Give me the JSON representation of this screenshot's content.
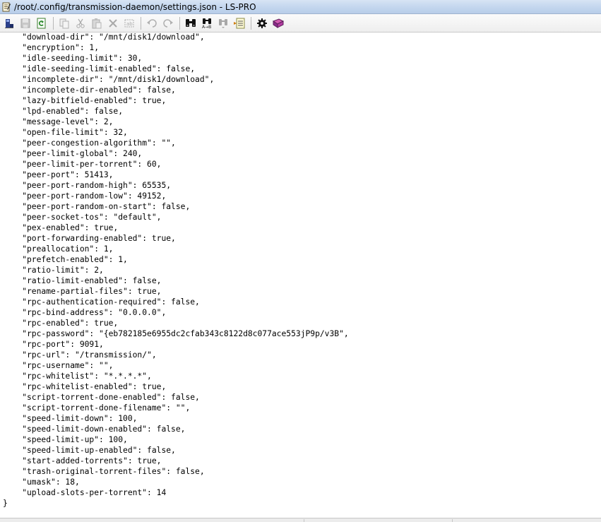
{
  "window": {
    "title": "/root/.config/transmission-daemon/settings.json - LS-PRO"
  },
  "toolbar": {
    "buttons": [
      {
        "name": "open-remote-icon",
        "enabled": true
      },
      {
        "name": "save-icon",
        "enabled": false
      },
      {
        "name": "reload-icon",
        "enabled": true
      },
      {
        "name": "copy-icon",
        "enabled": false
      },
      {
        "name": "cut-icon",
        "enabled": false
      },
      {
        "name": "paste-icon",
        "enabled": false
      },
      {
        "name": "delete-icon",
        "enabled": false
      },
      {
        "name": "select-all-icon",
        "enabled": false
      },
      {
        "name": "undo-icon",
        "enabled": false
      },
      {
        "name": "redo-icon",
        "enabled": false
      },
      {
        "name": "find-icon",
        "enabled": true
      },
      {
        "name": "replace-icon",
        "enabled": true
      },
      {
        "name": "find-next-icon",
        "enabled": false
      },
      {
        "name": "go-to-line-icon",
        "enabled": true
      },
      {
        "name": "settings-icon",
        "enabled": true
      },
      {
        "name": "help-icon",
        "enabled": true
      }
    ]
  },
  "editor": {
    "lines": [
      "    \"download-dir\": \"/mnt/disk1/download\",",
      "    \"encryption\": 1,",
      "    \"idle-seeding-limit\": 30,",
      "    \"idle-seeding-limit-enabled\": false,",
      "    \"incomplete-dir\": \"/mnt/disk1/download\",",
      "    \"incomplete-dir-enabled\": false,",
      "    \"lazy-bitfield-enabled\": true,",
      "    \"lpd-enabled\": false,",
      "    \"message-level\": 2,",
      "    \"open-file-limit\": 32,",
      "    \"peer-congestion-algorithm\": \"\",",
      "    \"peer-limit-global\": 240,",
      "    \"peer-limit-per-torrent\": 60,",
      "    \"peer-port\": 51413,",
      "    \"peer-port-random-high\": 65535,",
      "    \"peer-port-random-low\": 49152,",
      "    \"peer-port-random-on-start\": false,",
      "    \"peer-socket-tos\": \"default\",",
      "    \"pex-enabled\": true,",
      "    \"port-forwarding-enabled\": true,",
      "    \"preallocation\": 1,",
      "    \"prefetch-enabled\": 1,",
      "    \"ratio-limit\": 2,",
      "    \"ratio-limit-enabled\": false,",
      "    \"rename-partial-files\": true,",
      "    \"rpc-authentication-required\": false,",
      "    \"rpc-bind-address\": \"0.0.0.0\",",
      "    \"rpc-enabled\": true,",
      "    \"rpc-password\": \"{eb782185e6955dc2cfab343c8122d8c077ace553jP9p/v3B\",",
      "    \"rpc-port\": 9091,",
      "    \"rpc-url\": \"/transmission/\",",
      "    \"rpc-username\": \"\",",
      "    \"rpc-whitelist\": \"*.*.*.*\",",
      "    \"rpc-whitelist-enabled\": true,",
      "    \"script-torrent-done-enabled\": false,",
      "    \"script-torrent-done-filename\": \"\",",
      "    \"speed-limit-down\": 100,",
      "    \"speed-limit-down-enabled\": false,",
      "    \"speed-limit-up\": 100,",
      "    \"speed-limit-up-enabled\": false,",
      "    \"start-added-torrents\": true,",
      "    \"trash-original-torrent-files\": false,",
      "    \"umask\": 18,",
      "    \"upload-slots-per-torrent\": 14",
      "}"
    ]
  }
}
